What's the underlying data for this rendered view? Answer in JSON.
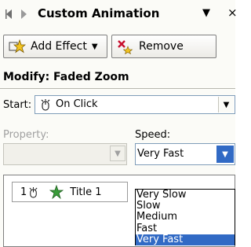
{
  "header": {
    "title": "Custom Animation",
    "back_icon": "back-arrow-icon",
    "forward_icon": "forward-arrow-icon",
    "menu_caret": "▼",
    "close": "×"
  },
  "toolbar": {
    "add_effect_label": "Add Effect",
    "add_effect_caret": "▼",
    "remove_label": "Remove"
  },
  "modify": {
    "label": "Modify: Faded Zoom"
  },
  "start": {
    "label": "Start:",
    "value": "On Click",
    "caret": "▼"
  },
  "property": {
    "label": "Property:",
    "value": "",
    "caret": "▼"
  },
  "speed": {
    "label": "Speed:",
    "value": "Very Fast",
    "caret": "▼",
    "options": [
      "Very Slow",
      "Slow",
      "Medium",
      "Fast",
      "Very Fast"
    ],
    "selected_index": 4
  },
  "effects": [
    {
      "number": "1",
      "name": "Title 1"
    }
  ],
  "colors": {
    "selection": "#316ac5",
    "pane_bg": "#fbfbf7"
  }
}
